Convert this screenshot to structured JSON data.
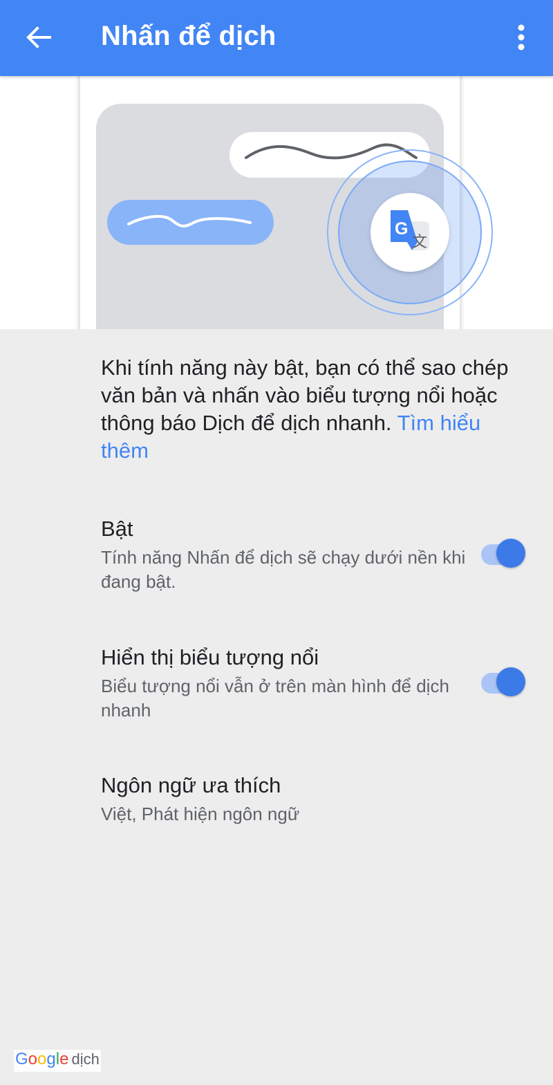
{
  "appbar": {
    "title": "Nhấn để dịch",
    "back_icon": "arrow-back-icon",
    "more_icon": "more-vert-icon",
    "color": "#4285f4"
  },
  "hero": {
    "illustration": "tap-to-translate-illustration",
    "badge_letters": [
      "G",
      "文"
    ]
  },
  "description": {
    "text": "Khi tính năng này bật, bạn có thể sao chép văn bản và nhấn vào biểu tượng nổi hoặc thông báo Dịch để dịch nhanh. ",
    "link": "Tìm hiểu thêm"
  },
  "settings": [
    {
      "title": "Bật",
      "subtitle": "Tính năng Nhấn để dịch sẽ chạy dưới nền khi đang bật.",
      "toggle": true
    },
    {
      "title": "Hiển thị biểu tượng nổi",
      "subtitle": "Biểu tượng nổi vẫn ở trên màn hình để dịch nhanh",
      "toggle": true
    },
    {
      "title": "Ngôn ngữ ưa thích",
      "subtitle": "Việt, Phát hiện ngôn ngữ"
    }
  ],
  "watermark": {
    "google_letters": [
      "G",
      "o",
      "o",
      "g",
      "l",
      "e"
    ],
    "suffix": "dịch"
  },
  "colors": {
    "accent": "#4285f4",
    "toggle_thumb": "#3c7ae8",
    "toggle_track": "#aac4f6",
    "background": "#ededee"
  }
}
